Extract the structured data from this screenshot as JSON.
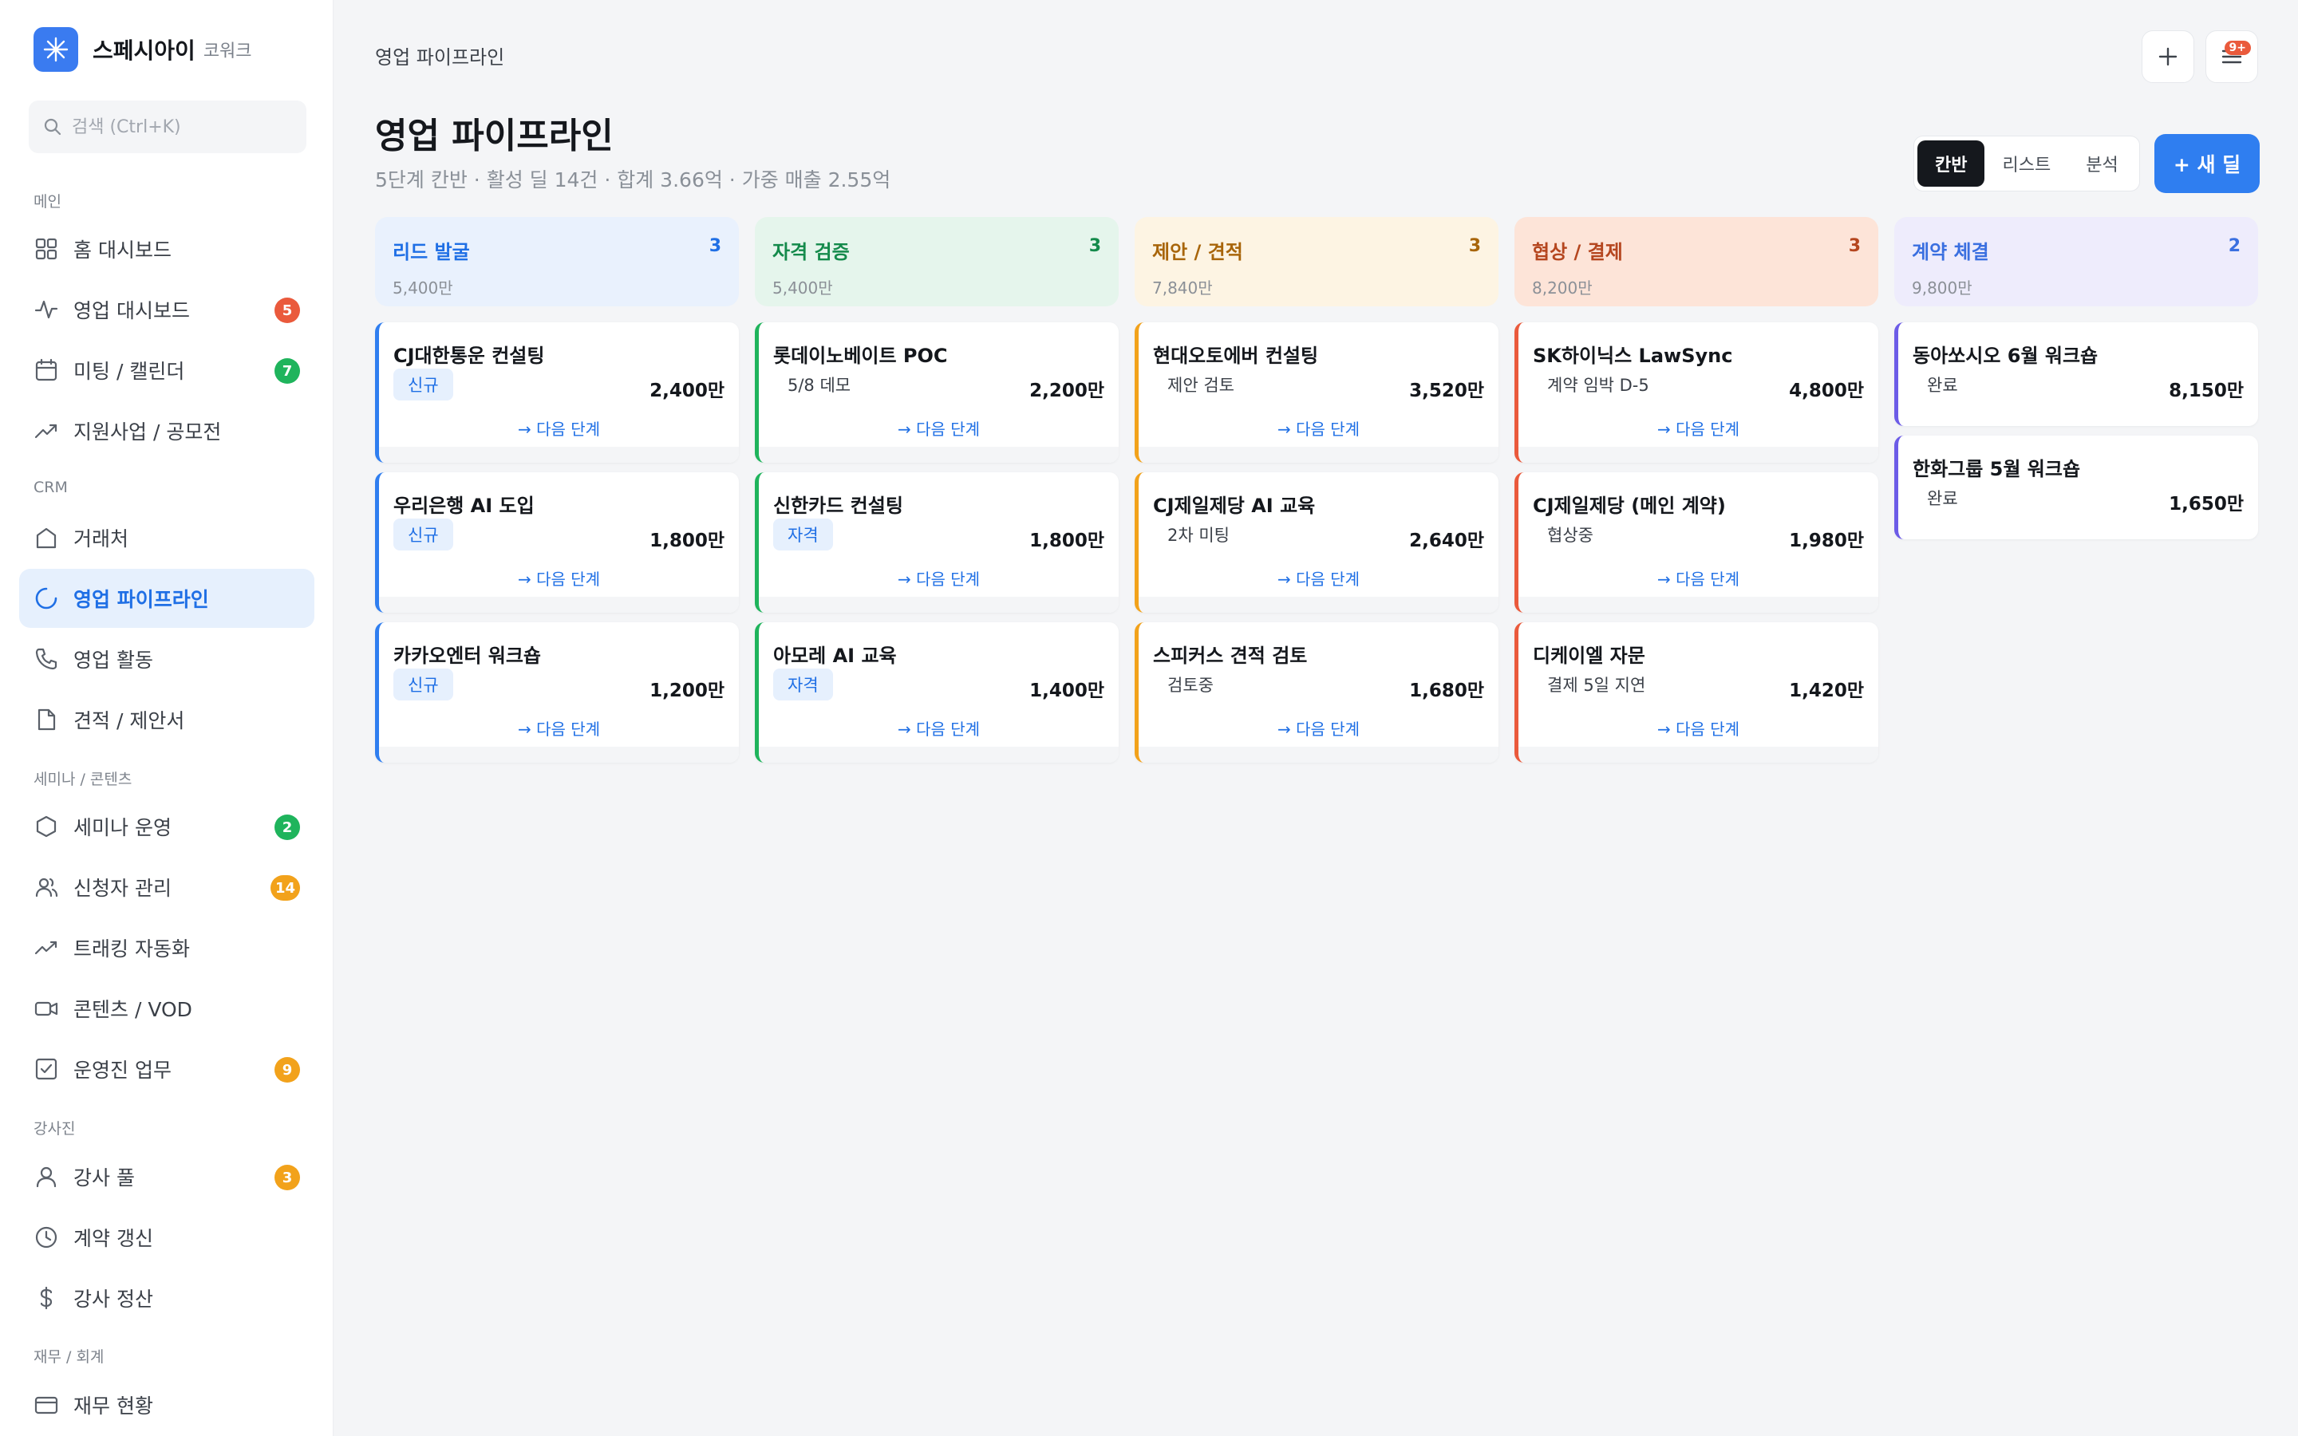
{
  "brand": {
    "name": "스페시아이",
    "sub": "코워크"
  },
  "search": {
    "placeholder": "검색 (Ctrl+K)"
  },
  "sidebar": {
    "sections": [
      {
        "title": "메인"
      },
      {
        "title": "CRM"
      },
      {
        "title": "세미나 / 콘텐츠"
      },
      {
        "title": "강사진"
      },
      {
        "title": "재무 / 회계"
      }
    ],
    "items": [
      {
        "label": "홈 대시보드",
        "icon": "grid-icon"
      },
      {
        "label": "영업 대시보드",
        "icon": "activity-icon",
        "badge": "5"
      },
      {
        "label": "미팅 / 캘린더",
        "icon": "calendar-icon",
        "badge": "7"
      },
      {
        "label": "지원사업 / 공모전",
        "icon": "trending-up-icon"
      },
      {
        "label": "거래처",
        "icon": "building-icon"
      },
      {
        "label": "영업 파이프라인",
        "icon": "loader-icon"
      },
      {
        "label": "영업 활동",
        "icon": "phone-icon"
      },
      {
        "label": "견적 / 제안서",
        "icon": "file-icon"
      },
      {
        "label": "세미나 운영",
        "icon": "hexagon-icon",
        "badge": "2"
      },
      {
        "label": "신청자 관리",
        "icon": "users-icon",
        "badge": "14"
      },
      {
        "label": "트래킹 자동화",
        "icon": "trending-icon"
      },
      {
        "label": "콘텐츠 / VOD",
        "icon": "video-icon"
      },
      {
        "label": "운영진 업무",
        "icon": "checkbox-icon",
        "badge": "9"
      },
      {
        "label": "강사 풀",
        "icon": "user-icon",
        "badge": "3"
      },
      {
        "label": "계약 갱신",
        "icon": "clock-icon"
      },
      {
        "label": "강사 정산",
        "icon": "dollar-icon"
      },
      {
        "label": "재무 현황",
        "icon": "card-icon"
      }
    ]
  },
  "header": {
    "breadcrumb": "영업 파이프라인",
    "notif_badge": "9+",
    "title": "영업 파이프라인",
    "subtitle": "5단계 칸반 · 활성 딜 14건 · 합계 3.66억 · 가중 매출 2.55억"
  },
  "views": {
    "kanban": "칸반",
    "list": "리스트",
    "analysis": "분석"
  },
  "new_deal": "+ 새 딜",
  "colors": {
    "blue": "#2f7ef0",
    "green": "#1fb45c",
    "orange": "#f2a21b",
    "red": "#ea5a3c",
    "purple": "#6c5ce7"
  },
  "columns": [
    {
      "name": "리드 발굴",
      "count": "3",
      "total": "5,400만",
      "cards": [
        {
          "title": "CJ대한통운 컨설팅",
          "tag": "신규",
          "amount": "2,400만",
          "next": "→ 다음 단계"
        },
        {
          "title": "우리은행 AI 도입",
          "tag": "신규",
          "amount": "1,800만",
          "next": "→ 다음 단계"
        },
        {
          "title": "카카오엔터 워크숍",
          "tag": "신규",
          "amount": "1,200만",
          "next": "→ 다음 단계"
        }
      ]
    },
    {
      "name": "자격 검증",
      "count": "3",
      "total": "5,400만",
      "cards": [
        {
          "title": "롯데이노베이트 POC",
          "tag": "5/8 데모",
          "amount": "2,200만",
          "next": "→ 다음 단계"
        },
        {
          "title": "신한카드 컨설팅",
          "tag": "자격",
          "amount": "1,800만",
          "next": "→ 다음 단계"
        },
        {
          "title": "아모레 AI 교육",
          "tag": "자격",
          "amount": "1,400만",
          "next": "→ 다음 단계"
        }
      ]
    },
    {
      "name": "제안 / 견적",
      "count": "3",
      "total": "7,840만",
      "cards": [
        {
          "title": "현대오토에버 컨설팅",
          "tag": "제안 검토",
          "amount": "3,520만",
          "next": "→ 다음 단계"
        },
        {
          "title": "CJ제일제당 AI 교육",
          "tag": "2차 미팅",
          "amount": "2,640만",
          "next": "→ 다음 단계"
        },
        {
          "title": "스피커스 견적 검토",
          "tag": "검토중",
          "amount": "1,680만",
          "next": "→ 다음 단계"
        }
      ]
    },
    {
      "name": "협상 / 결제",
      "count": "3",
      "total": "8,200만",
      "cards": [
        {
          "title": "SK하이닉스 LawSync",
          "tag": "계약 임박 D-5",
          "amount": "4,800만",
          "next": "→ 다음 단계"
        },
        {
          "title": "CJ제일제당 (메인 계약)",
          "tag": "협상중",
          "amount": "1,980만",
          "next": "→ 다음 단계"
        },
        {
          "title": "디케이엘 자문",
          "tag": "결제 5일 지연",
          "amount": "1,420만",
          "next": "→ 다음 단계"
        }
      ]
    },
    {
      "name": "계약 체결",
      "count": "2",
      "total": "9,800만",
      "cards": [
        {
          "title": "동아쏘시오 6월 워크숍",
          "tag": "완료",
          "amount": "8,150만"
        },
        {
          "title": "한화그룹 5월 워크숍",
          "tag": "완료",
          "amount": "1,650만"
        }
      ]
    }
  ]
}
